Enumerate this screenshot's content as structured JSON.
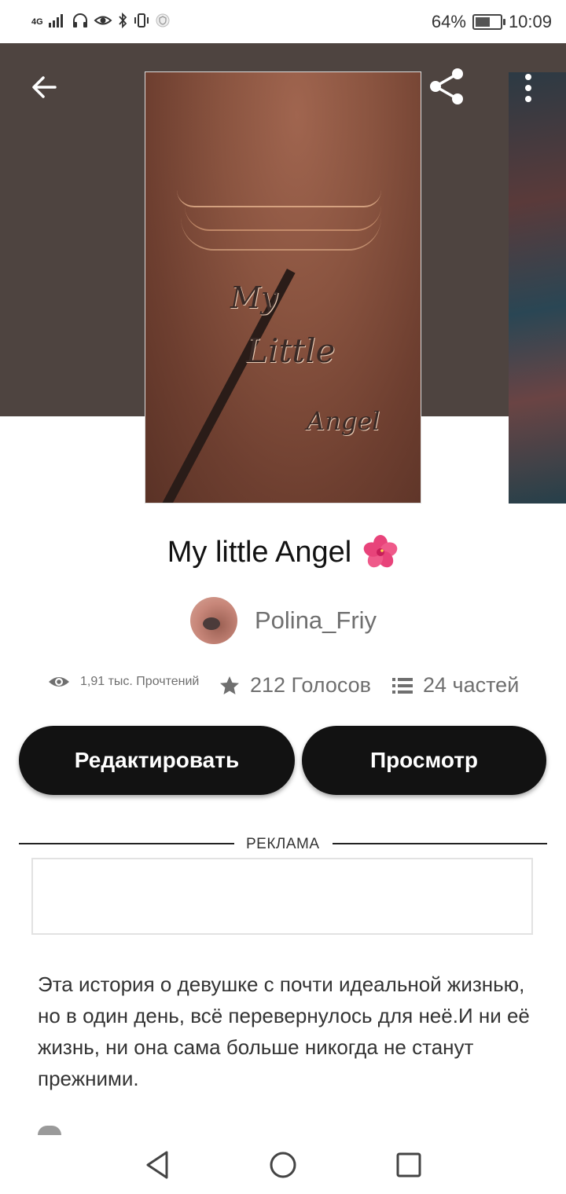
{
  "status_bar": {
    "network": "4G",
    "battery_percent": "64%",
    "battery_level": 0.64,
    "time": "10:09"
  },
  "story": {
    "cover_text": [
      "My",
      "Little",
      "Angel"
    ],
    "title": "My little Angel",
    "title_emoji": "hibiscus-flower",
    "author": "Polina_Friy",
    "stats": {
      "reads": "1,91 тыс. Прочтений",
      "votes": "212 Голосов",
      "parts": "24 частей"
    },
    "description": "Эта история о девушке с почти идеальной жизнью, но в один день, всё перевернулось для неё.И ни её жизнь, ни она сама больше никогда не станут прежними."
  },
  "actions": {
    "edit_label": "Редактировать",
    "view_label": "Просмотр"
  },
  "ad": {
    "label": "РЕКЛАМА"
  },
  "icons": {
    "back": "arrow-left-icon",
    "share": "share-icon",
    "more": "more-vertical-icon",
    "reads": "eye-icon",
    "votes": "star-icon",
    "parts": "list-icon"
  },
  "colors": {
    "header_bg": "#4e4440",
    "button_bg": "#121212",
    "muted_text": "#6f6f6f"
  }
}
